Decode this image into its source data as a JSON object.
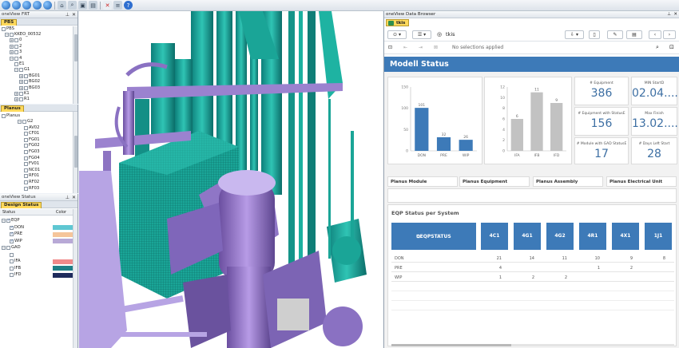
{
  "toolbar": {
    "icons": [
      "globe-icon",
      "globe-icon",
      "globe-icon",
      "globe-icon",
      "globe-icon",
      "home-icon",
      "search-icon",
      "cube-icon",
      "image-icon",
      "filter-icon",
      "layers-icon",
      "help-icon"
    ],
    "help_glyph": "?"
  },
  "frt_panel": {
    "title": "oneView FRT",
    "tab": "PBS",
    "root": "PBS",
    "items": [
      {
        "label": "KKEO_00532",
        "expander": "−"
      },
      {
        "label": "0",
        "expander": "+"
      },
      {
        "label": "2",
        "expander": "+"
      },
      {
        "label": "3",
        "expander": "+"
      },
      {
        "label": "4",
        "expander": "−"
      },
      {
        "label": "E1",
        "expander": ""
      },
      {
        "label": "G1",
        "expander": "−"
      },
      {
        "label": "BG01",
        "expander": "+"
      },
      {
        "label": "BG02",
        "expander": "+"
      },
      {
        "label": "BG03",
        "expander": "+"
      },
      {
        "label": "K1",
        "expander": "+"
      },
      {
        "label": "R1",
        "expander": "+"
      }
    ]
  },
  "planus_panel": {
    "tab": "Planus",
    "root": "Planus",
    "items": [
      "G2",
      "AV02",
      "CF01",
      "FG01",
      "FG02",
      "FG03",
      "FG04",
      "FV01",
      "NC01",
      "RF01",
      "RF02",
      "RF03"
    ]
  },
  "status_panel": {
    "title": "oneView Status",
    "tab": "Design Status",
    "col_status": "Status",
    "col_color": "Color",
    "groups": [
      {
        "label": "EQP",
        "items": [
          {
            "label": "DON",
            "color": "#5fc7d2"
          },
          {
            "label": "PRE",
            "color": "#f5c59a"
          },
          {
            "label": "WIP",
            "color": "#b8a9d6"
          }
        ]
      },
      {
        "label": "GAD",
        "items": [
          {
            "label": "IFA",
            "color": "#f08a8a"
          },
          {
            "label": "IFB",
            "color": "#1e7f86"
          },
          {
            "label": "IFD",
            "color": "#1f2b5c"
          }
        ]
      }
    ]
  },
  "data_browser": {
    "title": "oneView Data Browser",
    "tab": "tkis",
    "app_name": "tkis",
    "selections": "No selections applied",
    "sheet_title": "Modell Status",
    "kpis": [
      {
        "label": "# Equipment",
        "value": "386"
      },
      {
        "label": "MIN StartD",
        "value": "02.04...."
      },
      {
        "label": "# Equipment with StatusE",
        "value": "156"
      },
      {
        "label": "Max Finish",
        "value": "13.02...."
      },
      {
        "label": "# Module with GAD StatusE",
        "value": "17"
      },
      {
        "label": "# Days Left Start",
        "value": "28"
      }
    ],
    "filters": [
      "Planus Module",
      "Planus Equipment",
      "Planus Assembly",
      "Planus Electrical Unit"
    ],
    "table": {
      "title": "EQP Status per System",
      "corner": "EQPSTATUS",
      "columns": [
        "4C1",
        "4G1",
        "4G2",
        "4R1",
        "4X1",
        "1J1"
      ],
      "rows": [
        {
          "label": "DON",
          "values": [
            "21",
            "14",
            "11",
            "10",
            "9",
            "8"
          ]
        },
        {
          "label": "PRE",
          "values": [
            "4",
            "",
            "",
            "1",
            "2",
            ""
          ]
        },
        {
          "label": "WIP",
          "values": [
            "1",
            "2",
            "2",
            "",
            "",
            ""
          ]
        }
      ]
    }
  },
  "chart_data": [
    {
      "type": "bar",
      "categories": [
        "DON",
        "PRE",
        "WIP"
      ],
      "values": [
        101,
        32,
        26
      ],
      "ylim": [
        0,
        150
      ],
      "yticks": [
        0,
        50,
        100,
        150
      ],
      "color": "#3d7ab8",
      "grid": false
    },
    {
      "type": "bar",
      "categories": [
        "IFA",
        "IFB",
        "IFD"
      ],
      "values": [
        6,
        11,
        9
      ],
      "ylim": [
        0,
        12
      ],
      "yticks": [
        0,
        2,
        4,
        6,
        8,
        10,
        12
      ],
      "color": "#c2c2c2",
      "grid": false
    }
  ]
}
